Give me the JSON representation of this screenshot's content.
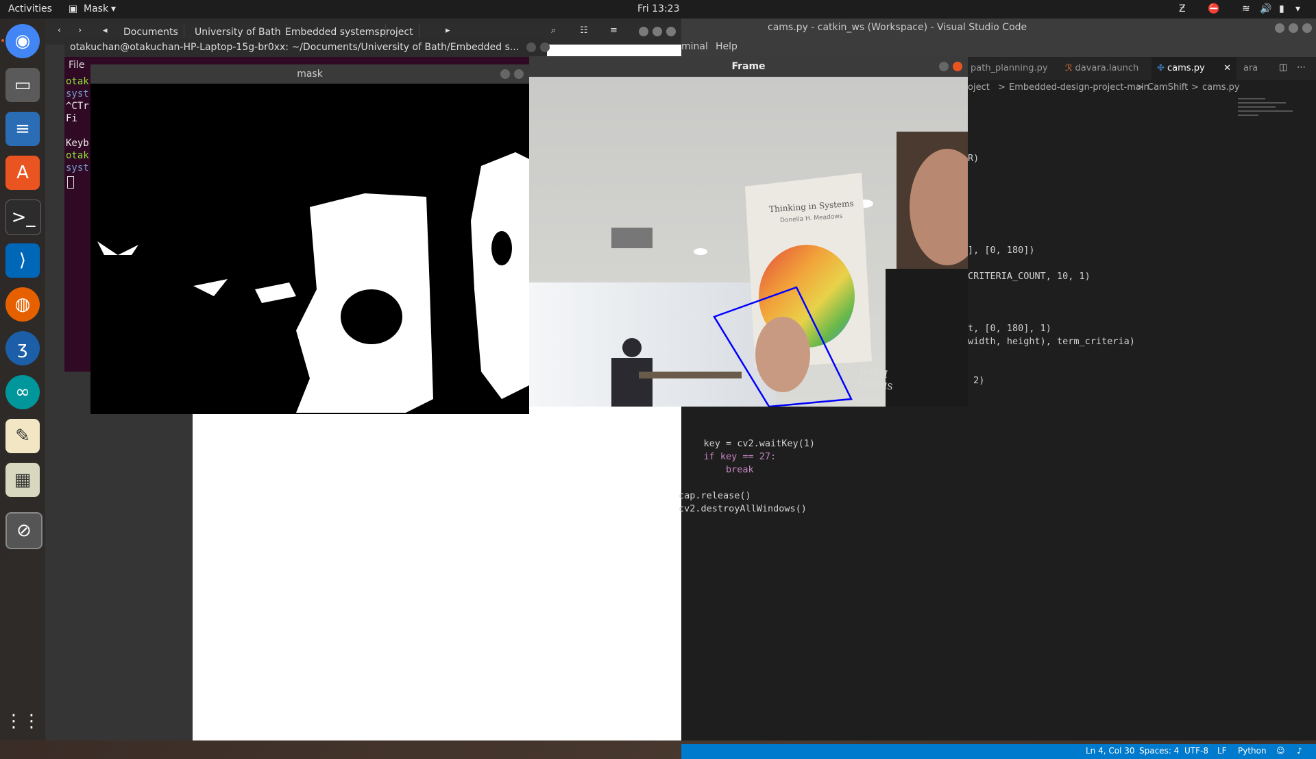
{
  "topbar": {
    "activities": "Activities",
    "app": "Mask",
    "clock": "Fri 13:23"
  },
  "dock": {
    "icons": [
      "chrome-icon",
      "files-icon",
      "writer-icon",
      "software-icon",
      "terminal-icon",
      "vscode-icon",
      "firefox-icon",
      "bluetooth-app-icon",
      "arduino-icon",
      "text-editor-icon",
      "image-viewer-icon",
      "media-icon",
      "apps-grid-icon"
    ]
  },
  "files": {
    "path": [
      "Documents",
      "University of Bath",
      "Embedded systems",
      "project"
    ]
  },
  "terminal": {
    "title": "otakuchan@otakuchan-HP-Laptop-15g-br0xx: ~/Documents/University of Bath/Embedded s...",
    "menu_file": "File",
    "lines": [
      "otak",
      "syst",
      "^CTr",
      "  Fi",
      "",
      "Keyb",
      "otak",
      "syst"
    ]
  },
  "mask": {
    "title": "mask"
  },
  "frame": {
    "title": "Frame",
    "book_title": "Thinking in Systems",
    "book_author": "Donella H. Meadows",
    "shirt_text": "BATH",
    "shirt_text2": "TENNIS"
  },
  "vscode": {
    "title": "cams.py - catkin_ws (Workspace) - Visual Studio Code",
    "menu": [
      "minal",
      "Help"
    ],
    "tabs": [
      "path_planning.py",
      "davara.launch",
      "cams.py",
      "ara"
    ],
    "breadcrumb": [
      "oject",
      ">",
      "Embedded-design-project-main",
      ">",
      "CamShift",
      ">",
      "cams.py"
    ],
    "code": [
      "R)",
      "], [0, 180])",
      "CRITERIA_COUNT, 10, 1)",
      "t, [0, 180], 1)",
      "width, height), term_criteria)",
      " 2)",
      "    key = cv2.waitKey(1)",
      "    if key == 27:",
      "        break",
      "cap.release()",
      "cv2.destroyAllWindows()"
    ],
    "status": [
      "Ln 4, Col 30",
      "Spaces: 4",
      "UTF-8",
      "LF",
      "Python"
    ]
  },
  "colors": {
    "ubuntu_orange": "#e95420",
    "vscode_blue": "#007acc",
    "terminal_bg": "#300a24"
  }
}
